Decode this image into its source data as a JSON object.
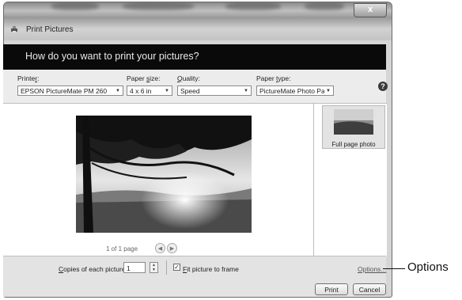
{
  "window": {
    "title": "Print Pictures",
    "close_glyph": "x"
  },
  "banner": {
    "question": "How do you want to print your pictures?"
  },
  "printer": {
    "label_pre": "Printe",
    "label_key": "r",
    "label_post": ":",
    "value": "EPSON PictureMate PM 260"
  },
  "paper_size": {
    "label_pre": "Paper ",
    "label_key": "s",
    "label_post": "ize:",
    "value": "4 x 6 in"
  },
  "quality": {
    "label_key": "Q",
    "label_post": "uality:",
    "value": "Speed"
  },
  "paper_type": {
    "label_pre": "Paper ",
    "label_key": "t",
    "label_post": "ype:",
    "value": "PictureMate Photo Pap"
  },
  "help": {
    "glyph": "?"
  },
  "thumbnail": {
    "caption": "Full page photo"
  },
  "pager": {
    "text": "1 of 1 page",
    "prev_glyph": "◀",
    "next_glyph": "▶"
  },
  "copies": {
    "label_key": "C",
    "label_post": "opies of each picture:",
    "value": "1",
    "up_glyph": "▲",
    "down_glyph": "▼"
  },
  "fit": {
    "checked_glyph": "✓",
    "label_key": "F",
    "label_post": "it picture to frame"
  },
  "options_link": "Options...",
  "buttons": {
    "print": "Print",
    "cancel": "Cancel"
  },
  "callout": "Options",
  "colors": {
    "banner_bg": "#0a0a0a",
    "window_bg": "#d6d6d6"
  },
  "icons": {
    "title": "printer-icon",
    "help": "help-icon",
    "dropdown": "chevron-down-icon"
  }
}
